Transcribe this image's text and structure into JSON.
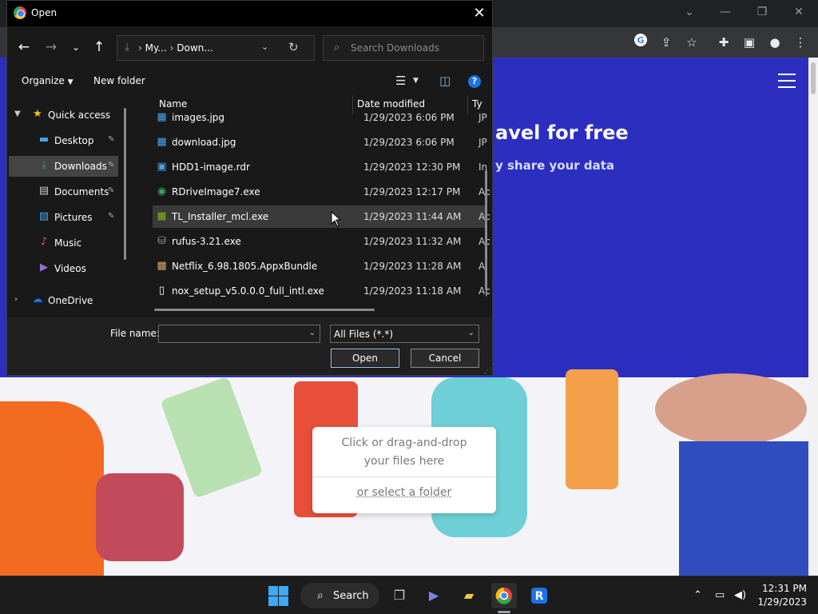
{
  "dialog": {
    "title": "Open",
    "address": {
      "crumbs": [
        "My...",
        "Down..."
      ],
      "separator": "›"
    },
    "search": {
      "placeholder": "Search Downloads"
    },
    "commands": {
      "organize": "Organize",
      "new_folder": "New folder"
    },
    "nav": [
      {
        "label": "Quick access",
        "icon": "star-icon",
        "expanded": true
      },
      {
        "label": "Desktop",
        "icon": "desktop-icon",
        "pinned": true
      },
      {
        "label": "Downloads",
        "icon": "download-icon",
        "pinned": true,
        "selected": true
      },
      {
        "label": "Documents",
        "icon": "documents-icon",
        "pinned": true
      },
      {
        "label": "Pictures",
        "icon": "pictures-icon",
        "pinned": true
      },
      {
        "label": "Music",
        "icon": "music-icon"
      },
      {
        "label": "Videos",
        "icon": "videos-icon"
      },
      {
        "label": "OneDrive",
        "icon": "cloud-icon"
      }
    ],
    "columns": {
      "name": "Name",
      "date": "Date modified",
      "type": "Ty"
    },
    "files": [
      {
        "name": "images.jpg",
        "date": "1/29/2023 6:06 PM",
        "type": "JP"
      },
      {
        "name": "download.jpg",
        "date": "1/29/2023 6:06 PM",
        "type": "JP"
      },
      {
        "name": "HDD1-image.rdr",
        "date": "1/29/2023 12:30 PM",
        "type": "In"
      },
      {
        "name": "RDriveImage7.exe",
        "date": "1/29/2023 12:17 PM",
        "type": "Ap"
      },
      {
        "name": "TL_Installer_mcl.exe",
        "date": "1/29/2023 11:44 AM",
        "type": "Ap",
        "hover": true
      },
      {
        "name": "rufus-3.21.exe",
        "date": "1/29/2023 11:32 AM",
        "type": "Ap"
      },
      {
        "name": "Netflix_6.98.1805.AppxBundle",
        "date": "1/29/2023 11:28 AM",
        "type": "Al"
      },
      {
        "name": "nox_setup_v5.0.0.0_full_intl.exe",
        "date": "1/29/2023 11:18 AM",
        "type": "Ap"
      }
    ],
    "file_name_label": "File name:",
    "file_name_value": "",
    "filter": "All Files (*.*)",
    "open_label": "Open",
    "cancel_label": "Cancel"
  },
  "webpage": {
    "hero_title": "avel for free",
    "hero_sub": "y share your data",
    "dropzone": {
      "line1": "Click or drag-and-drop",
      "line2": "your files here",
      "link": "or select a folder"
    }
  },
  "taskbar": {
    "search_label": "Search",
    "time": "12:31 PM",
    "date": "1/29/2023"
  },
  "colors": {
    "accent_blue": "#1a73e8",
    "page_purple": "#2c2ec0",
    "downloads_green": "#3ba55c"
  }
}
